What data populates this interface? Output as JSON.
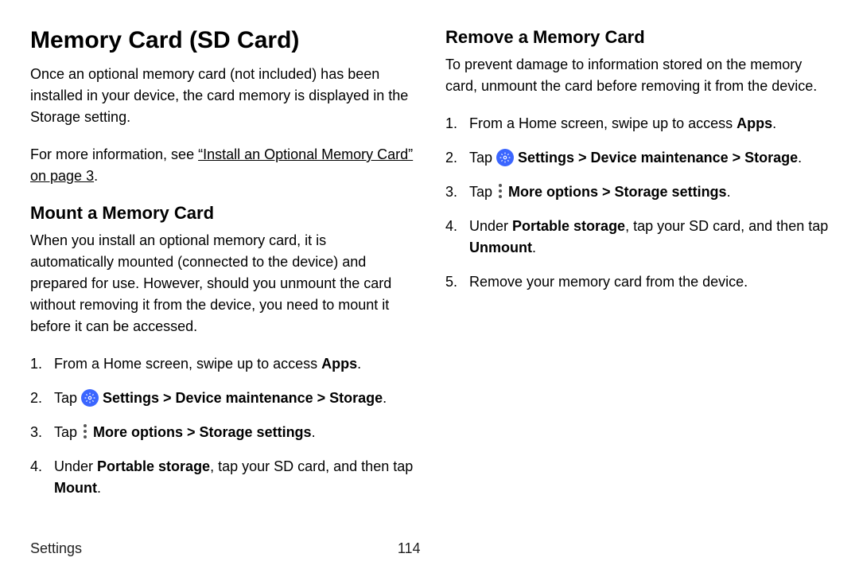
{
  "left": {
    "h1": "Memory Card (SD Card)",
    "intro": "Once an optional memory card (not included) has been installed in your device, the card memory is displayed in the Storage setting.",
    "moreInfoPrefix": "For more information, see ",
    "moreInfoLink": "“Install an Optional Memory Card” on page 3",
    "moreInfoSuffix": ".",
    "h2": "Mount a Memory Card",
    "mountIntro": "When you install an optional memory card, it is automatically mounted (connected to the device) and prepared for use. However, should you unmount the card without removing it from the device, you need to mount it before it can be accessed.",
    "steps": {
      "s1a": "From a Home screen, swipe up to access ",
      "s1b": "Apps",
      "s1c": ".",
      "s2a": "Tap ",
      "s2b": " Settings > Device maintenance > Storage",
      "s2c": ".",
      "s3a": "Tap ",
      "s3b": " More options > Storage settings",
      "s3c": ".",
      "s4a": "Under ",
      "s4b": "Portable storage",
      "s4c": ", tap your SD card, and then tap ",
      "s4d": "Mount",
      "s4e": "."
    }
  },
  "right": {
    "h2": "Remove a Memory Card",
    "intro": "To prevent damage to information stored on the memory card, unmount the card before removing it from the device.",
    "steps": {
      "s1a": "From a Home screen, swipe up to access ",
      "s1b": "Apps",
      "s1c": ".",
      "s2a": "Tap ",
      "s2b": " Settings > Device maintenance > Storage",
      "s2c": ".",
      "s3a": "Tap ",
      "s3b": " More options > Storage settings",
      "s3c": ".",
      "s4a": "Under ",
      "s4b": "Portable storage",
      "s4c": ", tap your SD card, and then tap ",
      "s4d": "Unmount",
      "s4e": ".",
      "s5": "Remove your memory card from the device."
    }
  },
  "footer": {
    "section": "Settings",
    "page": "114"
  }
}
